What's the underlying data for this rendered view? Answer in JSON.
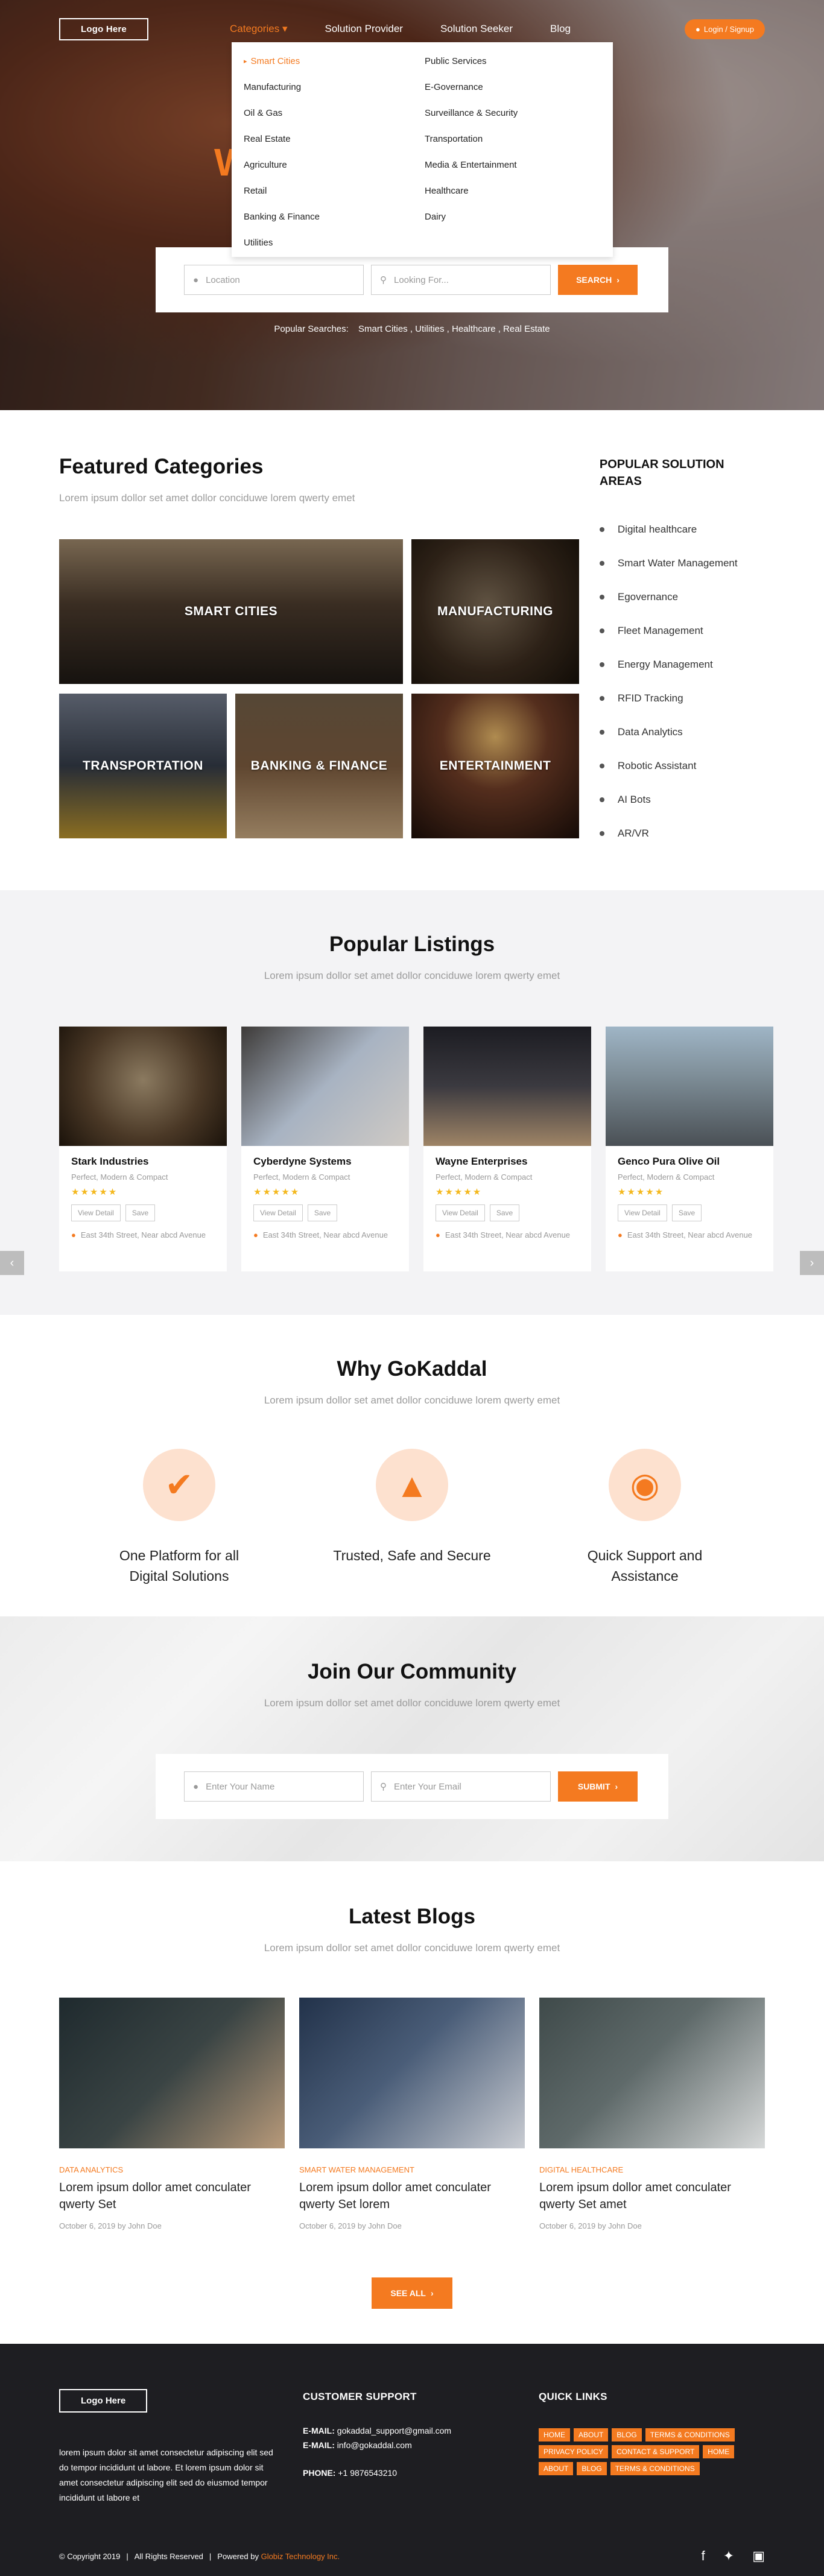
{
  "colors": {
    "accent": "#f47a20",
    "footer_bg": "#1e1e22"
  },
  "nav": {
    "logo": "Logo Here",
    "items": [
      "Categories",
      "Solution Provider",
      "Solution Seeker",
      "Blog"
    ],
    "login": "Login / Signup"
  },
  "dropdown": {
    "left": [
      "Smart Cities",
      "Manufacturing",
      "Oil & Gas",
      "Real Estate",
      "Agriculture",
      "Retail",
      "Banking & Finance",
      "Utilities"
    ],
    "right": [
      "Public Services",
      "E-Governance",
      "Surveillance & Security",
      "Transportation",
      "Media & Entertainment",
      "Healthcare",
      "Dairy"
    ]
  },
  "hero": {
    "letter": "W",
    "location_placeholder": "Location",
    "looking_placeholder": "Looking For...",
    "search_btn": "SEARCH",
    "popular_label": "Popular Searches:",
    "popular_items": "Smart Cities , Utilities , Healthcare , Real Estate"
  },
  "featured": {
    "title": "Featured Categories",
    "subtitle": "Lorem ipsum dollor set amet dollor conciduwe lorem qwerty emet",
    "categories": [
      "SMART CITIES",
      "MANUFACTURING",
      "TRANSPORTATION",
      "BANKING & FINANCE",
      "ENTERTAINMENT"
    ],
    "areas_title": "POPULAR SOLUTION AREAS",
    "areas": [
      "Digital healthcare",
      "Smart Water Management",
      "Egovernance",
      "Fleet Management",
      "Energy Management",
      "RFID Tracking",
      "Data Analytics",
      "Robotic Assistant",
      "AI Bots",
      "AR/VR"
    ]
  },
  "listings": {
    "title": "Popular Listings",
    "subtitle": "Lorem ipsum dollor set amet dollor conciduwe lorem qwerty emet",
    "cards": [
      {
        "name": "Stark Industries",
        "tag": "Perfect, Modern & Compact",
        "stars": "★★★★★",
        "view": "View Detail",
        "save": "Save",
        "addr": "East 34th Street, Near abcd Avenue"
      },
      {
        "name": "Cyberdyne Systems",
        "tag": "Perfect, Modern & Compact",
        "stars": "★★★★★",
        "view": "View Detail",
        "save": "Save",
        "addr": "East 34th Street, Near abcd Avenue"
      },
      {
        "name": "Wayne Enterprises",
        "tag": "Perfect, Modern & Compact",
        "stars": "★★★★★",
        "view": "View Detail",
        "save": "Save",
        "addr": "East 34th Street, Near abcd Avenue"
      },
      {
        "name": "Genco Pura Olive Oil",
        "tag": "Perfect, Modern & Compact",
        "stars": "★★★★★",
        "view": "View Detail",
        "save": "Save",
        "addr": "East 34th Street, Near abcd Avenue"
      }
    ]
  },
  "why": {
    "title": "Why GoKaddal",
    "subtitle": "Lorem ipsum dollor set amet dollor conciduwe lorem qwerty emet",
    "features": [
      "One Platform for all Digital Solutions",
      "Trusted, Safe and Secure",
      "Quick Support and Assistance"
    ]
  },
  "join": {
    "title": "Join Our Community",
    "subtitle": "Lorem ipsum dollor set amet dollor conciduwe lorem qwerty emet",
    "name_placeholder": "Enter Your Name",
    "email_placeholder": "Enter Your Email",
    "submit": "SUBMIT"
  },
  "blogs": {
    "title": "Latest Blogs",
    "subtitle": "Lorem ipsum dollor set amet dollor conciduwe lorem qwerty emet",
    "posts": [
      {
        "category": "DATA ANALYTICS",
        "title": "Lorem ipsum dollor amet conculater qwerty Set",
        "meta": "October 6, 2019 by John Doe"
      },
      {
        "category": "SMART WATER MANAGEMENT",
        "title": "Lorem ipsum dollor amet conculater qwerty Set lorem",
        "meta": "October 6, 2019 by John Doe"
      },
      {
        "category": "DIGITAL HEALTHCARE",
        "title": "Lorem ipsum dollor amet conculater qwerty Set amet",
        "meta": "October 6, 2019 by John Doe"
      }
    ],
    "see_all": "SEE ALL"
  },
  "footer": {
    "logo": "Logo Here",
    "text": "lorem ipsum dolor sit amet consectetur adipiscing elit sed do tempor incididunt ut labore. Et lorem ipsum dolor sit amet consectetur adipiscing elit sed do eiusmod tempor incididunt ut labore et",
    "support_title": "CUSTOMER SUPPORT",
    "email1_label": "E-MAIL:",
    "email1": "gokaddal_support@gmail.com",
    "email2_label": "E-MAIL:",
    "email2": "info@gokaddal.com",
    "phone_label": "PHONE:",
    "phone": "+1 9876543210",
    "links_title": "QUICK LINKS",
    "links": [
      "HOME",
      "ABOUT",
      "BLOG",
      "TERMS & CONDITIONS",
      "PRIVACY POLICY",
      "CONTACT & SUPPORT",
      "HOME",
      "ABOUT",
      "BLOG",
      "TERMS & CONDITIONS"
    ],
    "copyright": "© Copyright 2019",
    "rights": "All Rights Reserved",
    "powered_label": "Powered by",
    "powered_by": "Globiz Technology Inc."
  }
}
